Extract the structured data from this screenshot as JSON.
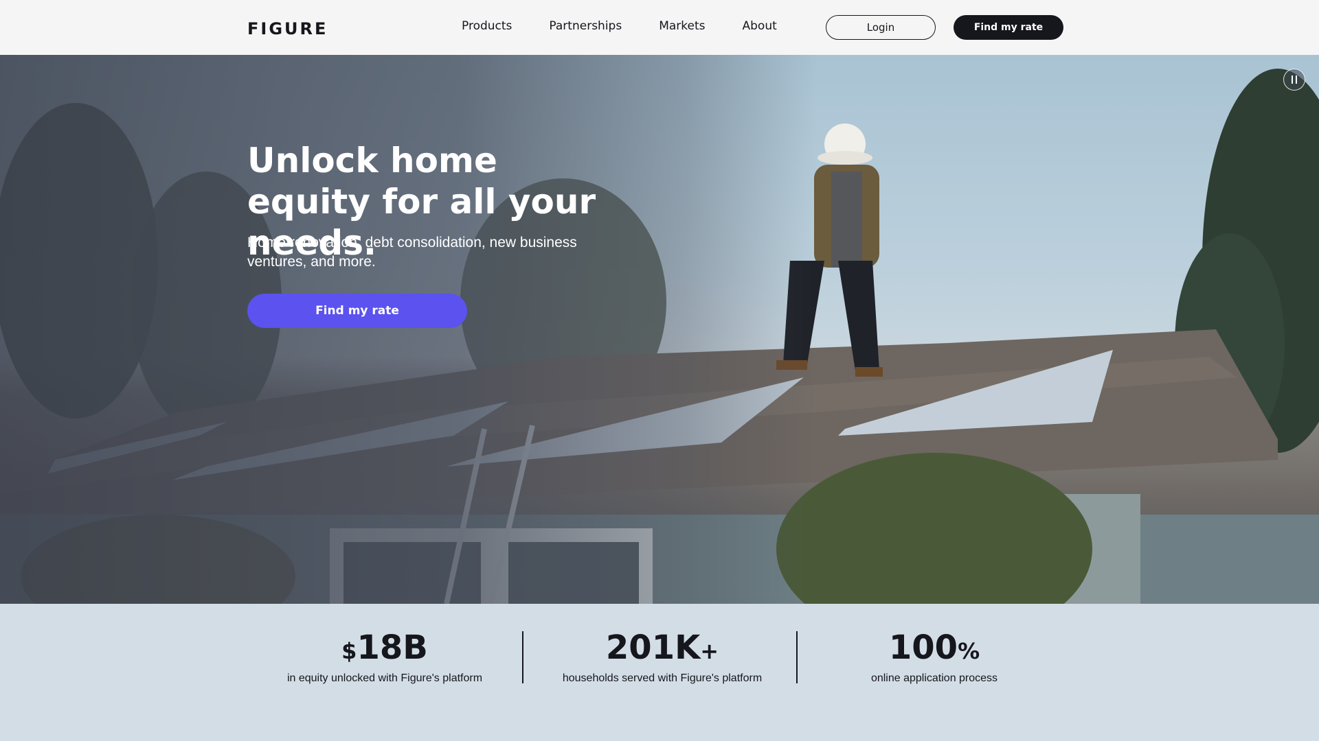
{
  "nav": {
    "logo": "FIGURE",
    "links": [
      "Products",
      "Partnerships",
      "Markets",
      "About"
    ],
    "login_label": "Login",
    "rate_label": "Find my rate"
  },
  "hero": {
    "title": "Unlock home equity for all your needs.",
    "subtitle": "Home renovation, debt consolidation, new business ventures, and more.",
    "cta_label": "Find my rate",
    "pause_icon": "pause-icon",
    "cta_color": "#5b52ef"
  },
  "stats": [
    {
      "value": "$18B",
      "prefix": "$",
      "main": "18B",
      "suffix": "",
      "label": "in equity unlocked with Figure's platform"
    },
    {
      "value": "201K+",
      "prefix": "",
      "main": "201K",
      "suffix": "+",
      "label": "households served with Figure's platform"
    },
    {
      "value": "100%",
      "prefix": "",
      "main": "100",
      "suffix": "%",
      "label": "online application process"
    }
  ],
  "colors": {
    "ink": "#16161d",
    "stats_background": "#d3dde5",
    "nav_background": "#f5f5f5"
  }
}
